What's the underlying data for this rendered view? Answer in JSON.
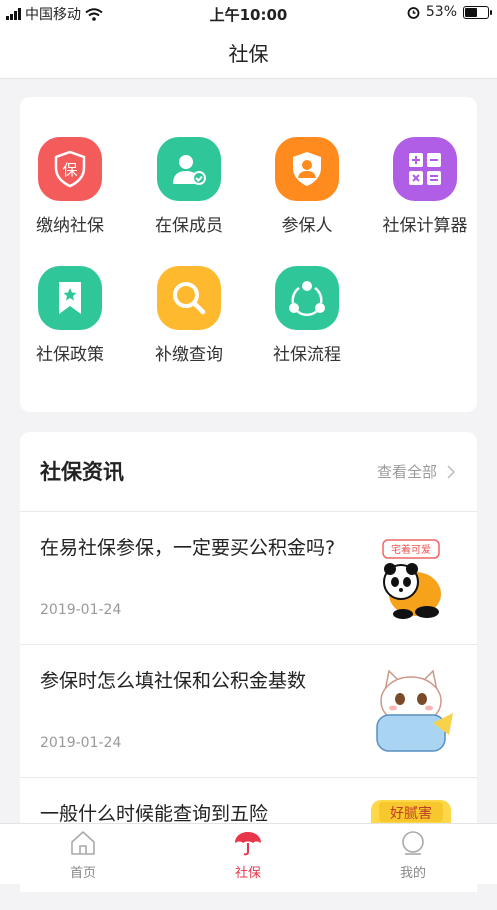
{
  "status_bar": {
    "carrier": "中国移动",
    "time": "上午10:00",
    "battery": "53%",
    "battery_level": 0.53
  },
  "nav": {
    "title": "社保"
  },
  "services": [
    {
      "label": "缴纳社保",
      "icon": "shield-bao-icon",
      "color": "#f45c5c",
      "icon_text": "保"
    },
    {
      "label": "在保成员",
      "icon": "member-icon",
      "color": "#2fc69a"
    },
    {
      "label": "参保人",
      "icon": "insured-person-icon",
      "color": "#ff8a1e"
    },
    {
      "label": "社保计算器",
      "icon": "calculator-icon",
      "color": "#b05ee6"
    },
    {
      "label": "社保政策",
      "icon": "policy-bookmark-icon",
      "color": "#2fc69a"
    },
    {
      "label": "补缴查询",
      "icon": "search-icon",
      "color": "#ffb92e"
    },
    {
      "label": "社保流程",
      "icon": "process-icon",
      "color": "#2fc69a"
    }
  ],
  "news": {
    "heading": "社保资讯",
    "more": "查看全部",
    "items": [
      {
        "title": "在易社保参保，一定要买公积金吗?",
        "date": "2019-01-24",
        "thumb": "panda-sticker",
        "thumb_text": "宅着可爱"
      },
      {
        "title": "参保时怎么填社保和公积金基数",
        "date": "2019-01-24",
        "thumb": "cat-pillow-sticker"
      },
      {
        "title": "一般什么时候能查询到五险",
        "date": "",
        "thumb": "banner-sticker",
        "thumb_text": "好腻害"
      }
    ]
  },
  "tabbar": {
    "items": [
      {
        "label": "首页",
        "icon": "home-icon",
        "active": false
      },
      {
        "label": "社保",
        "icon": "umbrella-icon",
        "active": true
      },
      {
        "label": "我的",
        "icon": "profile-icon",
        "active": false
      }
    ],
    "active_color": "#e8374b"
  }
}
